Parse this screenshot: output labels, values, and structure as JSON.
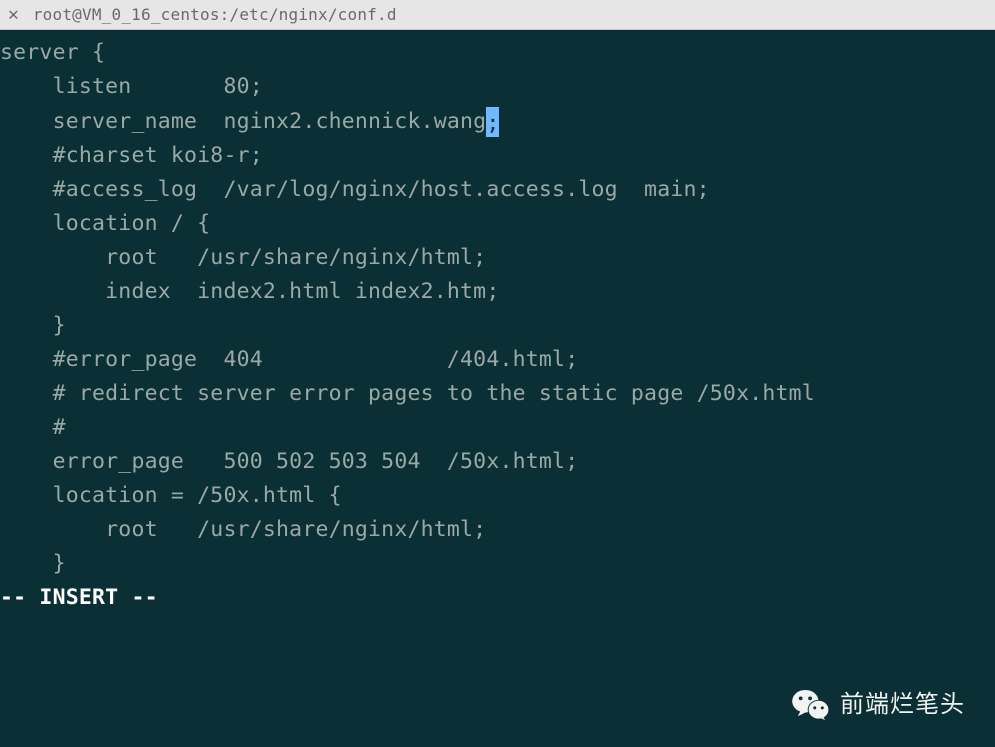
{
  "titlebar": {
    "close_glyph": "✕",
    "title": "root@VM_0_16_centos:/etc/nginx/conf.d"
  },
  "editor": {
    "lines": {
      "l0": "server {",
      "l1": "    listen       80;",
      "l2a": "    server_name  nginx2.chennick.wang",
      "l2b": ";",
      "l3": "",
      "l4": "    #charset koi8-r;",
      "l5": "    #access_log  /var/log/nginx/host.access.log  main;",
      "l6": "",
      "l7": "    location / {",
      "l8": "        root   /usr/share/nginx/html;",
      "l9": "        index  index2.html index2.htm;",
      "l10": "    }",
      "l11": "",
      "l12": "    #error_page  404              /404.html;",
      "l13": "",
      "l14": "    # redirect server error pages to the static page /50x.html",
      "l15": "    #",
      "l16": "    error_page   500 502 503 504  /50x.html;",
      "l17": "    location = /50x.html {",
      "l18": "        root   /usr/share/nginx/html;",
      "l19": "    }"
    },
    "mode_line": "-- INSERT --"
  },
  "watermark": {
    "text": "前端烂笔头",
    "icon": "wechat-icon"
  }
}
